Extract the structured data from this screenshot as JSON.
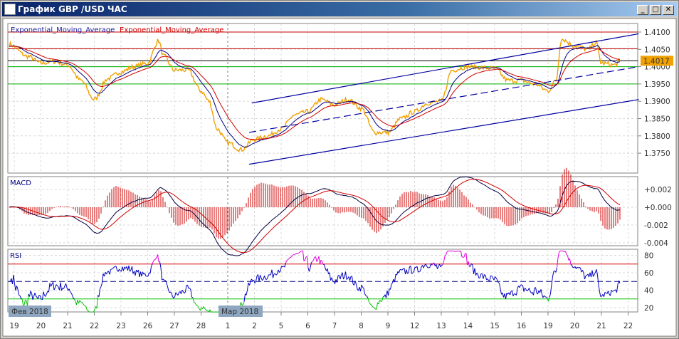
{
  "window": {
    "title": "График GBP /USD  ЧАС",
    "buttons": [
      "_",
      "□",
      "✕"
    ]
  },
  "legend": {
    "ema1": "Exponential_Moving_Average",
    "ema2": "Exponential_Moving_Average"
  },
  "colors": {
    "price": "#f0a000",
    "ema_fast": "#000080",
    "ema_slow": "#d00000",
    "macd": "#000040",
    "signal": "#d00000",
    "rsi": "#0000c0",
    "overbought": "#e000e0",
    "oversold": "#00c000"
  },
  "price_axis": {
    "ticks": [
      "1.4100",
      "1.4050",
      "1.4000",
      "1.3950",
      "1.3900",
      "1.3850",
      "1.3800",
      "1.3750"
    ],
    "current": "1.4017"
  },
  "macd": {
    "label": "MACD",
    "ticks": [
      "+0.002",
      "+0.000",
      "-0.002",
      "-0.004"
    ]
  },
  "rsi": {
    "label": "RSI",
    "ticks": [
      "80",
      "60",
      "40",
      "20"
    ]
  },
  "date_axis": {
    "days": [
      "19",
      "20",
      "21",
      "22",
      "23",
      "26",
      "27",
      "28",
      "1",
      "2",
      "5",
      "6",
      "7",
      "8",
      "9",
      "12",
      "13",
      "14",
      "15",
      "16",
      "19",
      "20",
      "21",
      "22"
    ],
    "month_labels": [
      "Фев 2018",
      "Мар 2018"
    ]
  },
  "chart_data": {
    "type": "line",
    "title": "График GBP /USD  ЧАС",
    "x_unit": "trading day index (0 = 19 Feb 2018)",
    "price_anchors": [
      [
        -0.2,
        1.4065
      ],
      [
        0.5,
        1.403
      ],
      [
        1,
        1.401
      ],
      [
        1.5,
        1.4015
      ],
      [
        2,
        1.4005
      ],
      [
        2.5,
        1.396
      ],
      [
        3,
        1.3905
      ],
      [
        3.5,
        1.3965
      ],
      [
        4,
        1.3985
      ],
      [
        4.5,
        1.4
      ],
      [
        5,
        1.401
      ],
      [
        5.4,
        1.4075
      ],
      [
        5.6,
        1.403
      ],
      [
        6,
        1.399
      ],
      [
        6.5,
        1.399
      ],
      [
        7,
        1.393
      ],
      [
        7.3,
        1.39
      ],
      [
        7.6,
        1.382
      ],
      [
        8,
        1.378
      ],
      [
        8.5,
        1.376
      ],
      [
        9,
        1.379
      ],
      [
        9.5,
        1.38
      ],
      [
        10,
        1.382
      ],
      [
        10.5,
        1.386
      ],
      [
        11,
        1.387
      ],
      [
        11.5,
        1.3905
      ],
      [
        12,
        1.389
      ],
      [
        12.5,
        1.3905
      ],
      [
        13,
        1.388
      ],
      [
        13.5,
        1.381
      ],
      [
        14,
        1.381
      ],
      [
        14.5,
        1.385
      ],
      [
        15,
        1.387
      ],
      [
        15.5,
        1.3895
      ],
      [
        16,
        1.39
      ],
      [
        16.4,
        1.399
      ],
      [
        17,
        1.4
      ],
      [
        18,
        1.3995
      ],
      [
        18.5,
        1.396
      ],
      [
        19,
        1.396
      ],
      [
        19.5,
        1.395
      ],
      [
        20,
        1.393
      ],
      [
        20.3,
        1.396
      ],
      [
        20.5,
        1.408
      ],
      [
        21,
        1.406
      ],
      [
        21.5,
        1.405
      ],
      [
        21.8,
        1.407
      ],
      [
        22,
        1.401
      ],
      [
        22.5,
        1.4005
      ],
      [
        22.7,
        1.4017
      ]
    ],
    "y_range": [
      1.372,
      1.4115
    ],
    "horizontal_levels": [
      {
        "price": 1.41,
        "color": "#c00000"
      },
      {
        "price": 1.4052,
        "color": "#c00000"
      },
      {
        "price": 1.4017,
        "color": "#000000"
      },
      {
        "price": 1.4,
        "color": "#00b000"
      },
      {
        "price": 1.395,
        "color": "#00b000"
      }
    ],
    "channel": {
      "upper": [
        [
          8.9,
          1.3895
        ],
        [
          23.4,
          1.4095
        ]
      ],
      "middle": [
        [
          8.8,
          1.381
        ],
        [
          23.4,
          1.4
        ],
        "dashed"
      ],
      "lower": [
        [
          8.8,
          1.3718
        ],
        [
          23.4,
          1.3905
        ]
      ]
    },
    "macd_range": [
      -0.0042,
      0.0037
    ],
    "rsi_range": [
      15,
      85
    ],
    "rsi_levels": [
      70,
      50,
      30
    ]
  }
}
